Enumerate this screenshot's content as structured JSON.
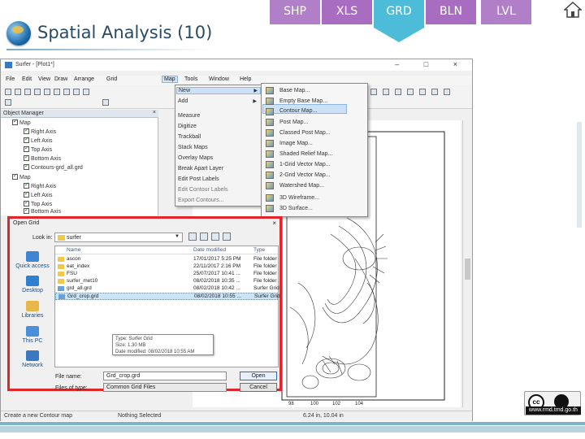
{
  "slide": {
    "title": "Spatial Analysis (10)",
    "tabs": [
      "SHP",
      "XLS",
      "GRD",
      "BLN",
      "LVL"
    ],
    "license_url": "www.rmd.tmd.go.th",
    "license_badge": "cc"
  },
  "surfer": {
    "window_title": "Surfer - [Plot1*]",
    "window_buttons": "– □ ×",
    "menubar": [
      "File",
      "Edit",
      "View",
      "Draw",
      "Arrange",
      "Grid",
      "Map",
      "Tools",
      "Window",
      "Help"
    ],
    "object_manager": {
      "title": "Object Manager",
      "close": "×",
      "items": [
        {
          "label": "Map",
          "indent": 0
        },
        {
          "label": "Right Axis",
          "indent": 2
        },
        {
          "label": "Left Axis",
          "indent": 2
        },
        {
          "label": "Top Axis",
          "indent": 2
        },
        {
          "label": "Bottom Axis",
          "indent": 2
        },
        {
          "label": "Contours-grd_all.grd",
          "indent": 2
        },
        {
          "label": "Map",
          "indent": 0
        },
        {
          "label": "Right Axis",
          "indent": 2
        },
        {
          "label": "Left Axis",
          "indent": 2
        },
        {
          "label": "Top Axis",
          "indent": 2
        },
        {
          "label": "Bottom Axis",
          "indent": 2
        }
      ]
    },
    "map_menu": {
      "items": [
        "New",
        "Add",
        "Measure",
        "Digitize",
        "Trackball",
        "Stack Maps",
        "Overlay Maps",
        "Break Apart Layer",
        "Edit Post Labels",
        "Edit Contour Labels",
        "Export Contours..."
      ]
    },
    "new_submenu": {
      "items": [
        "Base Map...",
        "Empty Base Map...",
        "Contour Map...",
        "Post Map...",
        "Classed Post Map...",
        "Image Map...",
        "Shaded Relief Map...",
        "1-Grid Vector Map...",
        "2-Grid Vector Map...",
        "Watershed Map...",
        "3D Wireframe...",
        "3D Surface..."
      ]
    },
    "status": {
      "left": "Create a new Contour map",
      "middle": "Nothing Selected",
      "right": "6.24 in, 10.04 in"
    },
    "axis_ticks": [
      "98",
      "100",
      "102",
      "104"
    ]
  },
  "dialog": {
    "title": "Open Grid",
    "close": "×",
    "look_in_label": "Look in:",
    "look_in_value": "surfer",
    "places": [
      "Quick access",
      "Desktop",
      "Libraries",
      "This PC",
      "Network"
    ],
    "columns": [
      "Name",
      "Date modified",
      "Type"
    ],
    "files": [
      {
        "name": "ascon",
        "date": "17/01/2017 5:25 PM",
        "type": "File folder"
      },
      {
        "name": "eat_index",
        "date": "22/11/2017 2:16 PM",
        "type": "File folder"
      },
      {
        "name": "FSU",
        "date": "25/07/2017 10:41 ...",
        "type": "File folder"
      },
      {
        "name": "surfer_met10",
        "date": "08/02/2018 10:35 ...",
        "type": "File folder"
      },
      {
        "name": "grd_all.grd",
        "date": "08/02/2018 10:42 ...",
        "type": "Surfer Grid"
      },
      {
        "name": "Grd_crop.grd",
        "date": "08/02/2018 10:55 ...",
        "type": "Surfer Grid"
      }
    ],
    "tooltip": [
      "Type: Surfer Grid",
      "Size: 1.30 MB",
      "Date modified: 08/02/2018 10:55 AM"
    ],
    "file_name_label": "File name:",
    "file_name_value": "Grd_crop.grd",
    "file_type_label": "Files of type:",
    "file_type_value": "Common Grid Files",
    "open_button": "Open",
    "cancel_button": "Cancel"
  },
  "colors": {
    "highlight_border": "#e0262b",
    "tab_active": "#4dbcd8",
    "tab_purple": "#a86cc0"
  }
}
